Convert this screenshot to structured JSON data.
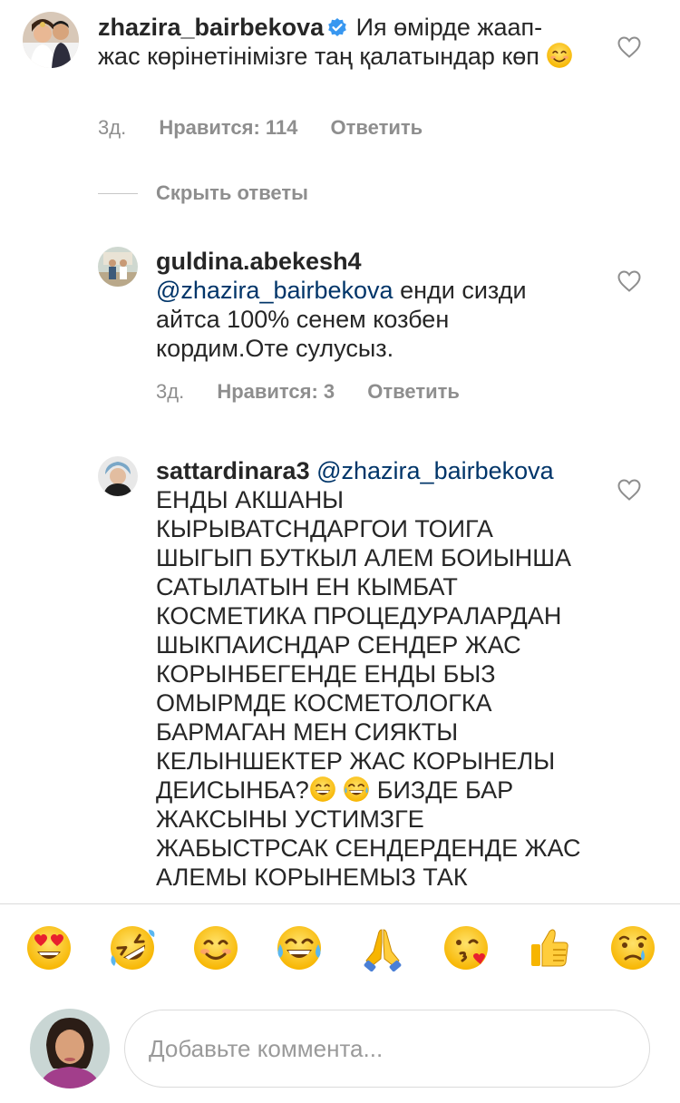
{
  "comments": [
    {
      "username": "zhazira_bairbekova",
      "verified": true,
      "text": "Ия өмірде жаап-жас көрінетінімізге таң қалатындар көп",
      "emoji": "smiling-face-emoji",
      "time": "3д.",
      "likes": "Нравится: 114",
      "reply": "Ответить"
    },
    {
      "username": "guldina.abekesh4",
      "mention": "@zhazira_bairbekova",
      "text": "енди сизди айтса 100% сенем козбен кордим.Оте сулусыз.",
      "time": "3д.",
      "likes": "Нравится: 3",
      "reply": "Ответить"
    },
    {
      "username": "sattardinara3",
      "mention": "@zhazira_bairbekova",
      "text_part1": "ЕНДЫ АКШАНЫ КЫРЫВАТСНДАРГОИ ТОИГА ШЫГЫП  БУТКЫЛ АЛЕМ БОИЫНША САТЫЛАТЫН ЕН КЫМБАТ КОСМЕТИКА ПРОЦЕДУРАЛАРДАН ШЫКПАИСНДАР СЕНДЕР ЖАС КОРЫНБЕГЕНДЕ ЕНДЫ БЫЗ ОМЫРМДЕ КОСМЕТОЛОГКА БАРМАГАН МЕН СИЯКТЫ КЕЛЫНШЕКТЕР ЖАС КОРЫНЕЛЫ ДЕИСЫНБА?",
      "text_part2": "БИЗДЕ БАР ЖАКСЫНЫ УСТИМЗГЕ ЖАБЫСТРСАК СЕНДЕРДЕНДЕ ЖАС АЛЕМЫ КОРЫНЕМЫЗ ТАК"
    }
  ],
  "hide_replies": "Скрыть ответы",
  "emoji_bar": [
    "heart-eyes",
    "rolling-on-floor-laughing",
    "smiling-face",
    "tears-of-joy",
    "folded-hands",
    "face-blowing-kiss",
    "thumbs-up",
    "crying-face"
  ],
  "composer": {
    "placeholder": "Добавьте коммента..."
  },
  "colors": {
    "text": "#262626",
    "meta": "#8e8e8e",
    "mention": "#003569",
    "verified": "#3897f0",
    "divider": "#dbdbdb"
  }
}
